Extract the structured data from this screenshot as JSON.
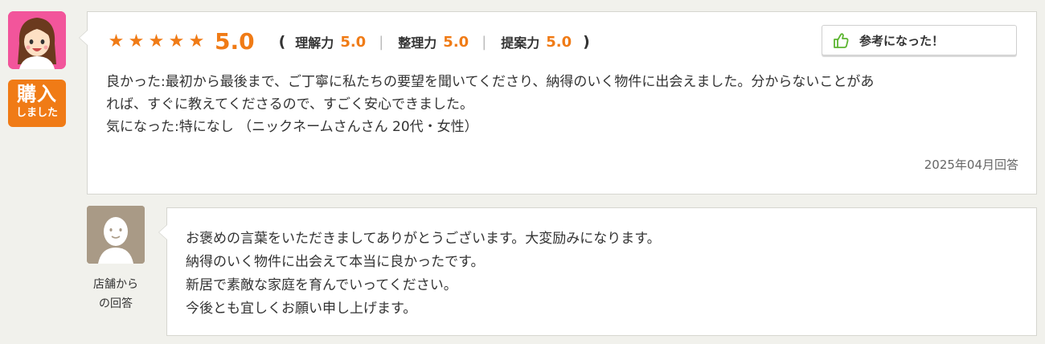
{
  "reviewer": {
    "avatar_icon": "female-user-avatar-icon",
    "avatar_color": "#f2559b",
    "badge": {
      "line1": "購入",
      "line2": "しました",
      "color": "#f07b16"
    }
  },
  "review": {
    "stars": [
      "★",
      "★",
      "★",
      "★",
      "★"
    ],
    "star_count": 5,
    "score": "5.0",
    "paren_open": "(",
    "paren_close": ")",
    "sub_ratings": [
      {
        "label": "理解力",
        "value": "5.0"
      },
      {
        "label": "整理力",
        "value": "5.0"
      },
      {
        "label": "提案力",
        "value": "5.0"
      }
    ],
    "helpful_button": {
      "label": "参考になった！",
      "icon": "thumbs-up-icon"
    },
    "lines": [
      "良かった:最初から最後まで、ご丁寧に私たちの要望を聞いてくださり、納得のいく物件に出会えました。分からないことがあ",
      "れば、すぐに教えてくださるので、すごく安心できました。",
      "気になった:特になし （ニックネームさんさん 20代・女性）"
    ],
    "date": "2025年04月回答",
    "accent_color": "#f07b16"
  },
  "reply": {
    "avatar_icon": "shop-staff-avatar-icon",
    "avatar_color": "#a99a86",
    "label_line1": "店舗から",
    "label_line2": "の回答",
    "lines": [
      "お褒めの言葉をいただきましてありがとうございます。大変励みになります。",
      "納得のいく物件に出会えて本当に良かったです。",
      "新居で素敵な家庭を育んでいってください。",
      "今後とも宜しくお願い申し上げます。"
    ]
  }
}
